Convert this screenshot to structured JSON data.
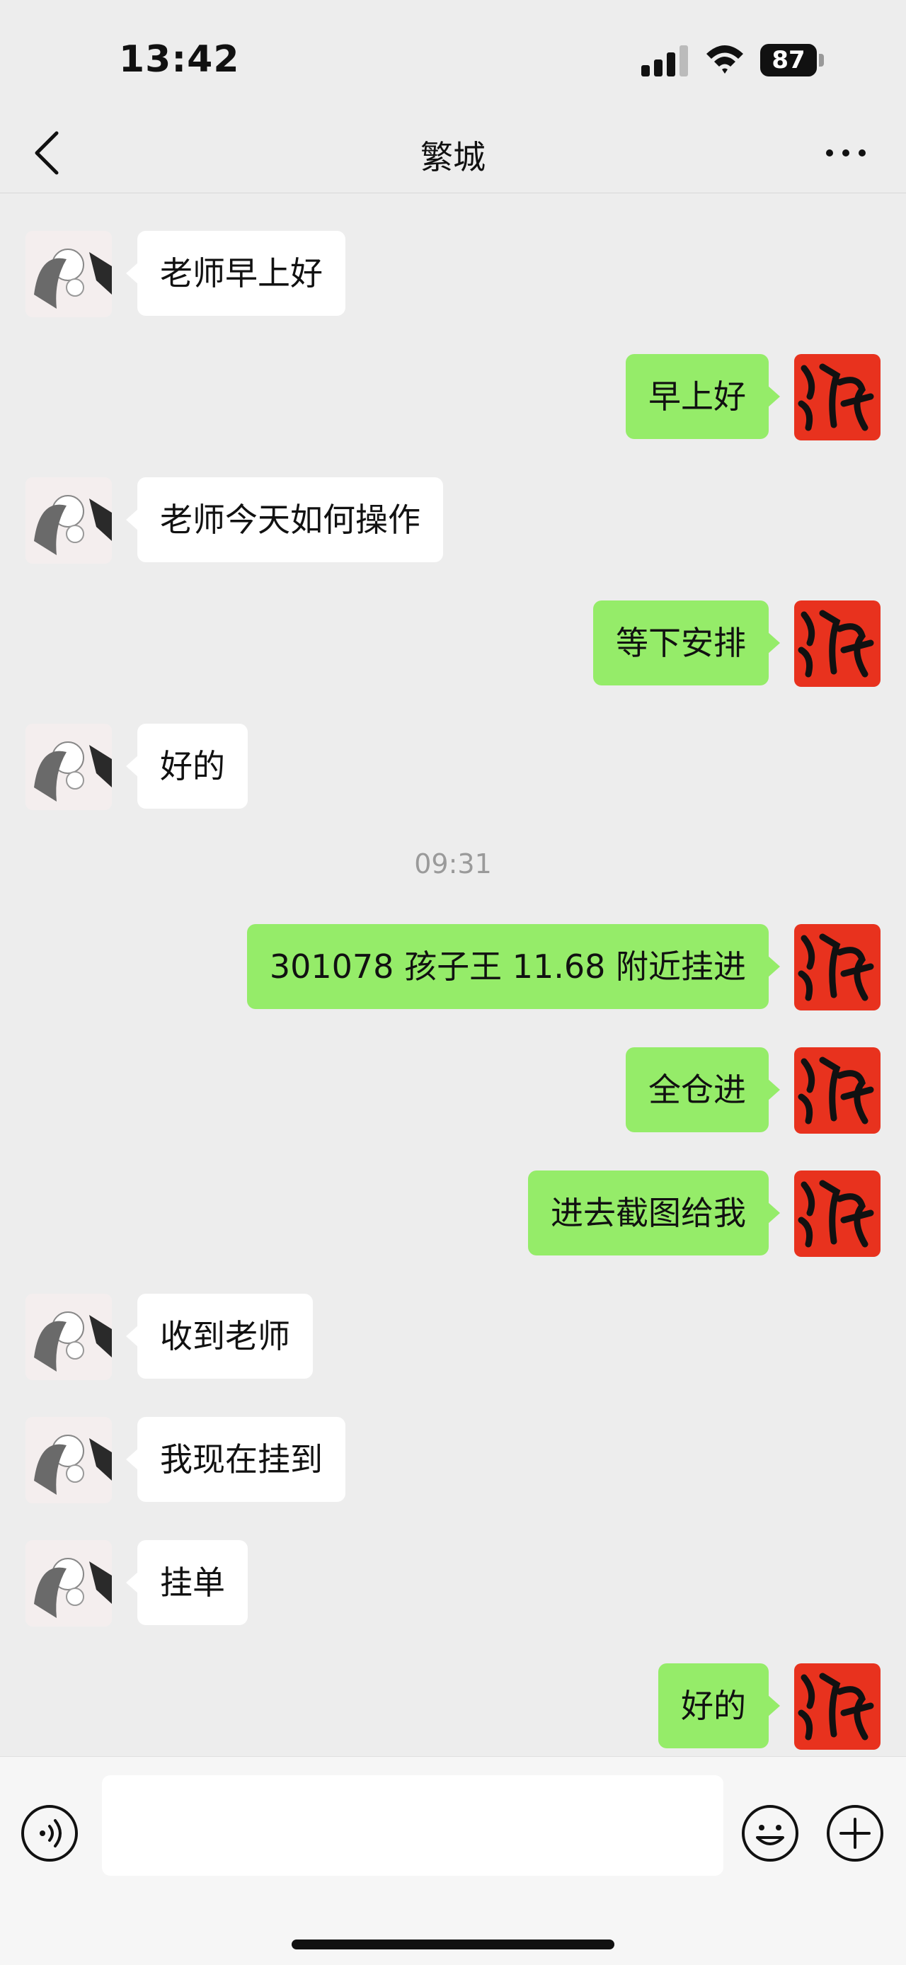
{
  "status_bar": {
    "time": "13:42",
    "battery": "87"
  },
  "nav": {
    "title": "繁城"
  },
  "messages": [
    {
      "side": "in",
      "text": "老师早上好"
    },
    {
      "side": "out",
      "text": "早上好"
    },
    {
      "side": "in",
      "text": "老师今天如何操作"
    },
    {
      "side": "out",
      "text": "等下安排"
    },
    {
      "side": "in",
      "text": "好的"
    },
    {
      "timestamp": "09:31"
    },
    {
      "side": "out",
      "text": "301078 孩子王 11.68 附近挂进"
    },
    {
      "side": "out",
      "text": "全仓进"
    },
    {
      "side": "out",
      "text": "进去截图给我"
    },
    {
      "side": "in",
      "text": "收到老师"
    },
    {
      "side": "in",
      "text": "我现在挂到"
    },
    {
      "side": "in",
      "text": "挂单"
    },
    {
      "side": "out",
      "text": "好的"
    }
  ],
  "colors": {
    "outgoing_bubble": "#95ec69",
    "incoming_bubble": "#ffffff",
    "background": "#ededed",
    "avatar_red": "#e8321e"
  },
  "icons": [
    "back-icon",
    "more-icon",
    "voice-icon",
    "emoji-icon",
    "plus-icon"
  ]
}
